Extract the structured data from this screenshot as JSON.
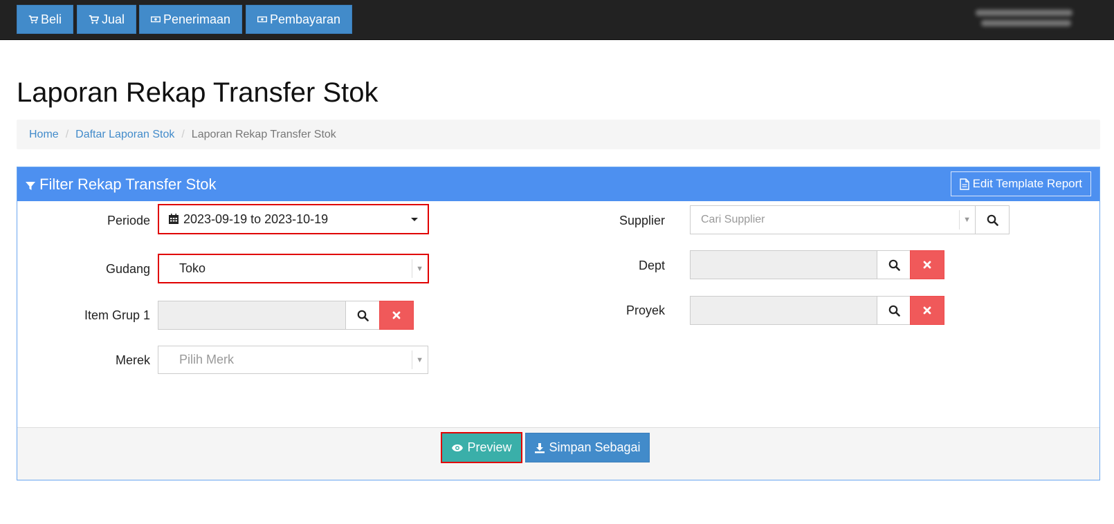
{
  "navbar": {
    "buttons": [
      {
        "label": "Beli",
        "icon": "cart-icon"
      },
      {
        "label": "Jual",
        "icon": "cart-icon"
      },
      {
        "label": "Penerimaan",
        "icon": "money-icon"
      },
      {
        "label": "Pembayaran",
        "icon": "money-icon"
      }
    ]
  },
  "page": {
    "title": "Laporan Rekap Transfer Stok"
  },
  "breadcrumb": {
    "home": "Home",
    "parent": "Daftar Laporan Stok",
    "current": "Laporan Rekap Transfer Stok"
  },
  "panel": {
    "title": "Filter Rekap Transfer Stok",
    "edit_template_label": "Edit Template Report"
  },
  "filters": {
    "periode_label": "Periode",
    "periode_value": "2023-09-19 to 2023-10-19",
    "gudang_label": "Gudang",
    "gudang_value": "Toko",
    "item_grup_label": "Item Grup 1",
    "merek_label": "Merek",
    "merek_placeholder": "Pilih Merk",
    "supplier_label": "Supplier",
    "supplier_placeholder": "Cari Supplier",
    "dept_label": "Dept",
    "proyek_label": "Proyek"
  },
  "footer": {
    "preview_label": "Preview",
    "save_label": "Simpan Sebagai"
  },
  "colors": {
    "navbar_bg": "#222222",
    "primary": "#428bca",
    "panel_heading": "#4d90f0",
    "danger": "#f0595a",
    "preview": "#3aafa9",
    "highlight": "#e00000"
  }
}
